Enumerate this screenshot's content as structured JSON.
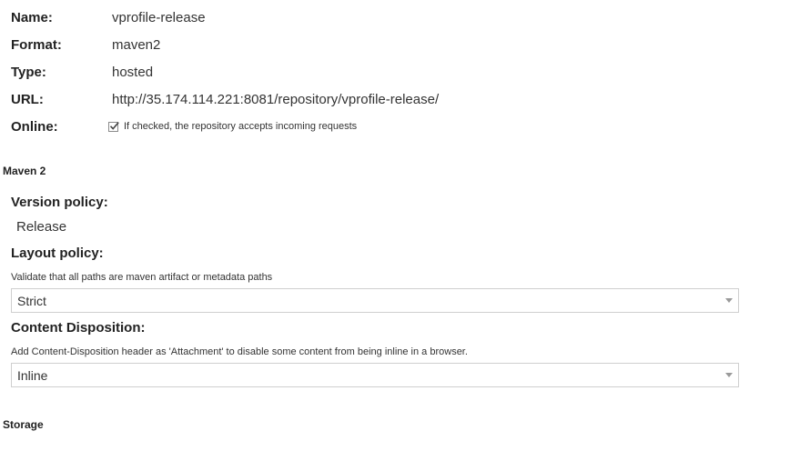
{
  "repository": {
    "name_label": "Name:",
    "name_value": "vprofile-release",
    "format_label": "Format:",
    "format_value": "maven2",
    "type_label": "Type:",
    "type_value": "hosted",
    "url_label": "URL:",
    "url_value": "http://35.174.114.221:8081/repository/vprofile-release/",
    "online_label": "Online:",
    "online_checked": true,
    "online_help": "If checked, the repository accepts incoming requests"
  },
  "maven": {
    "section_title": "Maven 2",
    "version_policy_label": "Version policy:",
    "version_policy_value": "Release",
    "layout_policy_label": "Layout policy:",
    "layout_policy_help": "Validate that all paths are maven artifact or metadata paths",
    "layout_policy_value": "Strict",
    "content_disposition_label": "Content Disposition:",
    "content_disposition_help": "Add Content-Disposition header as 'Attachment' to disable some content from being inline in a browser.",
    "content_disposition_value": "Inline"
  },
  "storage": {
    "section_title": "Storage"
  },
  "icons": {
    "checkbox": "check-icon",
    "dropdown": "chevron-down-icon"
  }
}
